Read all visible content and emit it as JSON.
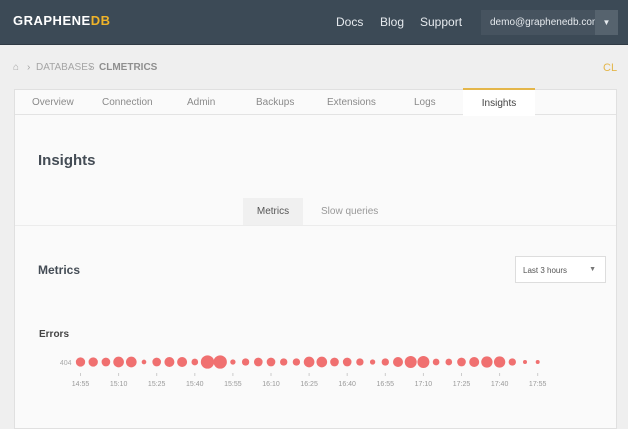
{
  "header": {
    "logo_main": "GRAPHENE",
    "logo_accent": "DB",
    "nav": [
      "Docs",
      "Blog",
      "Support"
    ],
    "user": "demo@graphenedb.com"
  },
  "breadcrumb": {
    "items": [
      "DATABASES",
      "CLMETRICS"
    ],
    "right": "CL"
  },
  "tabs": [
    "Overview",
    "Connection",
    "Admin",
    "Backups",
    "Extensions",
    "Logs",
    "Insights"
  ],
  "page_title": "Insights",
  "subtabs": [
    "Metrics",
    "Slow queries"
  ],
  "section_title": "Metrics",
  "range_select": "Last 3 hours",
  "chart_data": {
    "type": "scatter",
    "title": "Errors",
    "series": [
      {
        "name": "404",
        "values": [
          14,
          14,
          13,
          16,
          16,
          7,
          13,
          15,
          15,
          10,
          20,
          20,
          8,
          11,
          13,
          13,
          11,
          11,
          16,
          16,
          13,
          13,
          11,
          8,
          11,
          15,
          18,
          18,
          10,
          10,
          13,
          15,
          17,
          17,
          11,
          6,
          6
        ]
      }
    ],
    "x_start": "14:55",
    "x_step_minutes": 5,
    "tick_labels": [
      "14:55",
      "15:10",
      "15:25",
      "15:40",
      "15:55",
      "16:10",
      "16:25",
      "16:40",
      "16:55",
      "17:10",
      "17:25",
      "17:40",
      "17:55"
    ],
    "color": "#f07070"
  }
}
